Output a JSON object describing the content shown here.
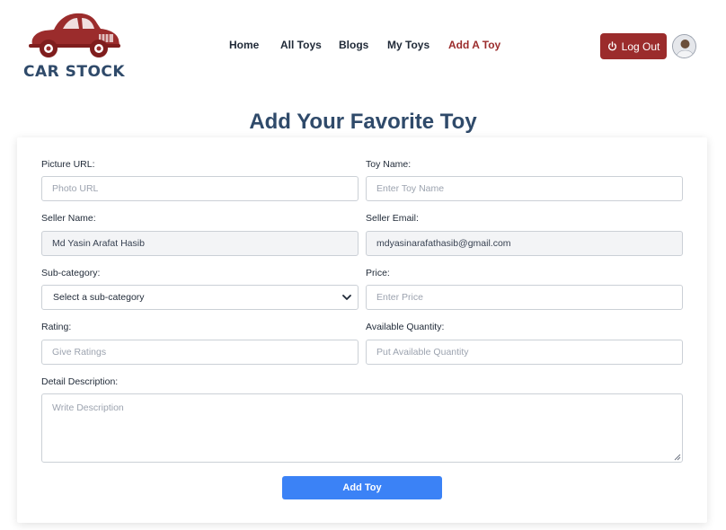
{
  "brand": {
    "name": "CAR STOCK",
    "logo_color": "#9b2c2c",
    "text_color": "#2f4a6a"
  },
  "nav": {
    "items": [
      {
        "label": "Home",
        "active": false
      },
      {
        "label": "All Toys",
        "active": false
      },
      {
        "label": "Blogs",
        "active": false
      },
      {
        "label": "My Toys",
        "active": false
      },
      {
        "label": "Add A Toy",
        "active": true
      }
    ],
    "active_color": "#9b2c2c"
  },
  "user": {
    "logout_label": "Log Out",
    "logout_icon": "power-icon",
    "avatar": "user-avatar"
  },
  "page": {
    "title": "Add Your Favorite Toy"
  },
  "form": {
    "picture_url": {
      "label": "Picture URL:",
      "placeholder": "Photo URL",
      "value": ""
    },
    "toy_name": {
      "label": "Toy Name:",
      "placeholder": "Enter Toy Name",
      "value": ""
    },
    "seller_name": {
      "label": "Seller Name:",
      "value": "Md Yasin Arafat Hasib"
    },
    "seller_email": {
      "label": "Seller Email:",
      "value": "mdyasinarafathasib@gmail.com"
    },
    "sub_category": {
      "label": "Sub-category:",
      "selected": "Select a sub-category"
    },
    "price": {
      "label": "Price:",
      "placeholder": "Enter Price",
      "value": ""
    },
    "rating": {
      "label": "Rating:",
      "placeholder": "Give Ratings",
      "value": ""
    },
    "quantity": {
      "label": "Available Quantity:",
      "placeholder": "Put Available Quantity",
      "value": ""
    },
    "description": {
      "label": "Detail Description:",
      "placeholder": "Write Description",
      "value": ""
    },
    "submit_label": "Add Toy",
    "submit_color": "#3b82f6"
  }
}
